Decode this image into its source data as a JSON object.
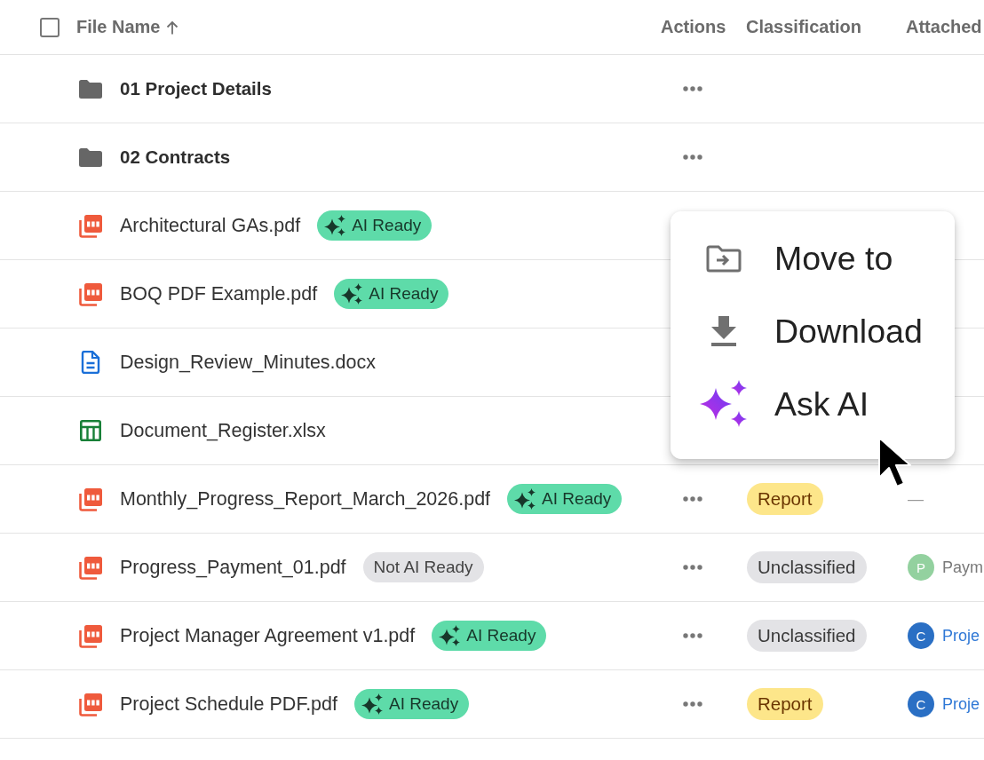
{
  "table": {
    "select_all": {
      "checked": false
    },
    "columns": [
      {
        "label": "File Name",
        "sorted": true
      },
      {
        "label": "Actions",
        "sorted": false
      },
      {
        "label": "Classification",
        "sorted": false
      },
      {
        "label": "Attached",
        "sorted": false
      }
    ],
    "rows": [
      {
        "kind": "folder",
        "name": "01 Project Details",
        "menu_button": true
      },
      {
        "kind": "folder",
        "name": "02 Contracts",
        "menu_button": true
      },
      {
        "kind": "pdf",
        "name": "Architectural GAs.pdf",
        "badge": {
          "kind": "ai_ready",
          "label": "AI Ready"
        },
        "menu_button": false
      },
      {
        "kind": "pdf",
        "name": "BOQ PDF Example.pdf",
        "badge": {
          "kind": "ai_ready",
          "label": "AI Ready"
        },
        "menu_button": false
      },
      {
        "kind": "docx",
        "name": "Design_Review_Minutes.docx",
        "menu_button": false
      },
      {
        "kind": "xlsx",
        "name": "Document_Register.xlsx",
        "menu_button": false
      },
      {
        "kind": "pdf",
        "name": "Monthly_Progress_Report_March_2026.pdf",
        "badge": {
          "kind": "ai_ready",
          "label": "AI Ready"
        },
        "menu_button": true,
        "classification": {
          "kind": "report",
          "label": "Report"
        },
        "attached": {
          "text": "—",
          "linked": false
        }
      },
      {
        "kind": "pdf",
        "name": "Progress_Payment_01.pdf",
        "badge": {
          "kind": "not_ready",
          "label": "Not AI Ready"
        },
        "menu_button": true,
        "classification": {
          "kind": "unclassified",
          "label": "Unclassified"
        },
        "attached": {
          "avatar": {
            "letter": "P",
            "color": "#93d19f"
          },
          "text": "Paym",
          "linked": false
        }
      },
      {
        "kind": "pdf",
        "name": "Project Manager Agreement v1.pdf",
        "badge": {
          "kind": "ai_ready",
          "label": "AI Ready"
        },
        "menu_button": true,
        "classification": {
          "kind": "unclassified",
          "label": "Unclassified"
        },
        "attached": {
          "avatar": {
            "letter": "C",
            "color": "#2a6fc4"
          },
          "text": "Proje",
          "linked": true
        }
      },
      {
        "kind": "pdf",
        "name": "Project Schedule PDF.pdf",
        "badge": {
          "kind": "ai_ready",
          "label": "AI Ready"
        },
        "menu_button": true,
        "classification": {
          "kind": "report",
          "label": "Report"
        },
        "attached": {
          "avatar": {
            "letter": "C",
            "color": "#2a6fc4"
          },
          "text": "Proje",
          "linked": true
        }
      }
    ]
  },
  "context_menu": {
    "items": [
      {
        "kind": "move",
        "label": "Move to"
      },
      {
        "kind": "download",
        "label": "Download"
      },
      {
        "kind": "ask_ai",
        "label": "Ask AI"
      }
    ]
  }
}
